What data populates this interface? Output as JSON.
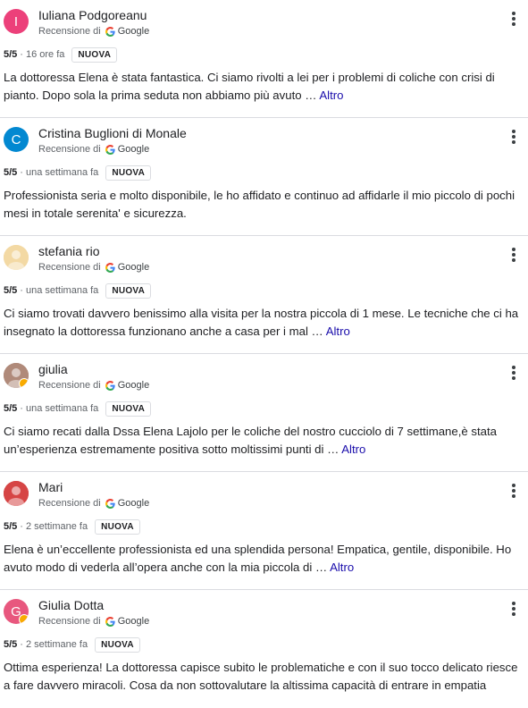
{
  "colors": {
    "link": "#1a0dab",
    "divider": "#dadce0"
  },
  "reviews": [
    {
      "avatar_letter": "I",
      "avatar_color": "#ec407a",
      "name": "Iuliana Podgoreanu",
      "source": "Recensione di",
      "source_brand": "Google",
      "score": "5/5",
      "time": "16 ore fa",
      "badge": "NUOVA",
      "text": "La dottoressa Elena è stata fantastica. Ci siamo rivolti a lei per i problemi di coliche con crisi di pianto. Dopo sola la prima seduta non abbiamo più avuto …",
      "more": "Altro"
    },
    {
      "avatar_letter": "C",
      "avatar_color": "#0288d1",
      "name": "Cristina Buglioni di Monale",
      "source": "Recensione di",
      "source_brand": "Google",
      "score": "5/5",
      "time": "una settimana fa",
      "badge": "NUOVA",
      "text": "Professionista seria e molto disponibile, le ho affidato e continuo ad affidarle il mio piccolo di pochi mesi in totale serenita' e sicurezza.",
      "more": ""
    },
    {
      "avatar_letter": "",
      "avatar_color": "#f3d9a4",
      "name": "stefania rio",
      "source": "Recensione di",
      "source_brand": "Google",
      "score": "5/5",
      "time": "una settimana fa",
      "badge": "NUOVA",
      "text": "Ci siamo trovati davvero benissimo alla visita per la nostra piccola di 1 mese. Le tecniche che ci ha insegnato la dottoressa funzionano anche a casa per i mal …",
      "more": "Altro"
    },
    {
      "avatar_letter": "",
      "avatar_color": "#b08a7a",
      "name": "giulia",
      "source": "Recensione di",
      "source_brand": "Google",
      "score": "5/5",
      "time": "una settimana fa",
      "badge": "NUOVA",
      "text": "Ci siamo recati dalla Dssa Elena Lajolo per le coliche del nostro cucciolo di 7 settimane,è stata un’esperienza estremamente positiva sotto moltissimi punti di …",
      "more": "Altro"
    },
    {
      "avatar_letter": "",
      "avatar_color": "#d64545",
      "name": "Mari",
      "source": "Recensione di",
      "source_brand": "Google",
      "score": "5/5",
      "time": "2 settimane fa",
      "badge": "NUOVA",
      "text": "Elena è un’eccellente professionista ed una splendida persona! Empatica, gentile, disponibile. Ho avuto modo di vederla all’opera anche con la mia piccola di …",
      "more": "Altro"
    },
    {
      "avatar_letter": "G",
      "avatar_color": "#e8577e",
      "name": "Giulia Dotta",
      "source": "Recensione di",
      "source_brand": "Google",
      "score": "5/5",
      "time": "2 settimane fa",
      "badge": "NUOVA",
      "text": "Ottima esperienza! La dottoressa capisce subito le problematiche e con il suo tocco delicato riesce a fare davvero miracoli. Cosa da non sottovalutare la altissima capacità di entrare in empatia",
      "more": ""
    }
  ]
}
